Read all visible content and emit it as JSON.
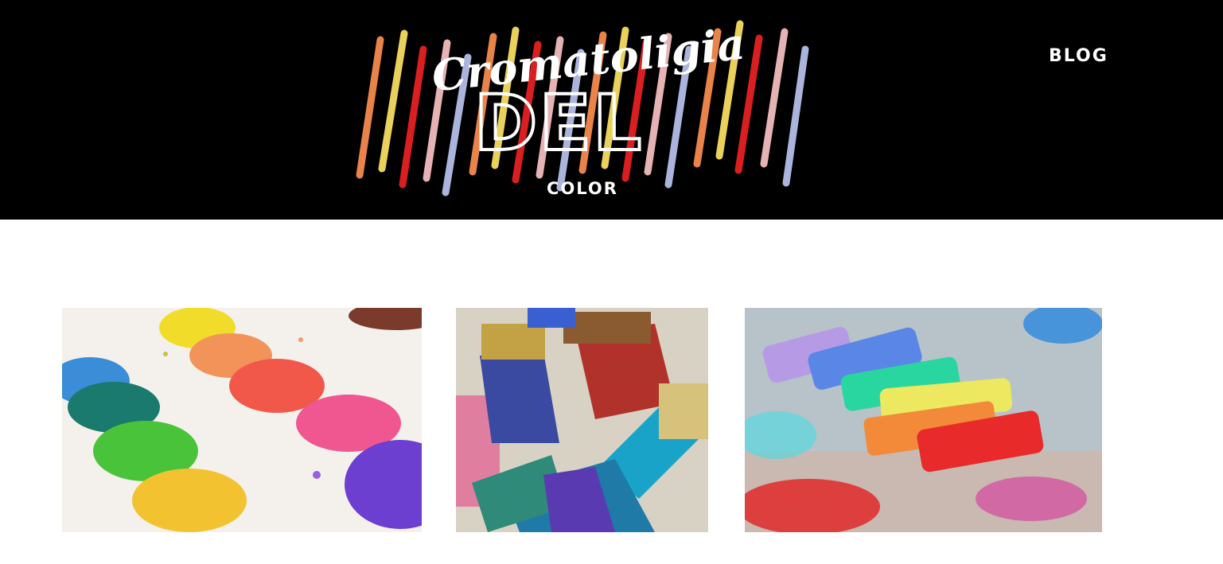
{
  "header": {
    "logo": {
      "script_text": "Cromatoligia",
      "big_text": "DEL",
      "small_text": "COLOR",
      "stick_colors": [
        "#e8834a",
        "#e9d15c",
        "#d91f1f",
        "#e5b3b3",
        "#aab4dc"
      ]
    },
    "nav": {
      "blog_label": "BLOG"
    }
  },
  "gallery": {
    "items": [
      {
        "icon": "watercolor-palette-image"
      },
      {
        "icon": "paint-brushes-image"
      },
      {
        "icon": "chalk-pastels-image"
      }
    ]
  },
  "colors": {
    "header_background": "#000000",
    "page_background": "#ffffff",
    "nav_text": "#ffffff"
  }
}
